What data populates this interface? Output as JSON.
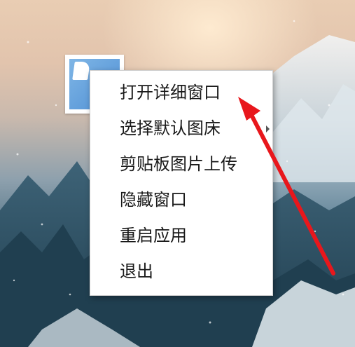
{
  "desktop": {
    "wallpaper": "snowy-forest-mountain-wallpaper"
  },
  "tray_icon": {
    "icon": "image-uploader-app-icon"
  },
  "context_menu": {
    "items": [
      {
        "label": "打开详细窗口",
        "has_submenu": false
      },
      {
        "label": "选择默认图床",
        "has_submenu": true
      },
      {
        "label": "剪贴板图片上传",
        "has_submenu": false
      },
      {
        "label": "隐藏窗口",
        "has_submenu": false
      },
      {
        "label": "重启应用",
        "has_submenu": false
      },
      {
        "label": "退出",
        "has_submenu": false
      }
    ]
  },
  "annotation": {
    "color": "#e8171c",
    "points_to": "打开详细窗口"
  }
}
